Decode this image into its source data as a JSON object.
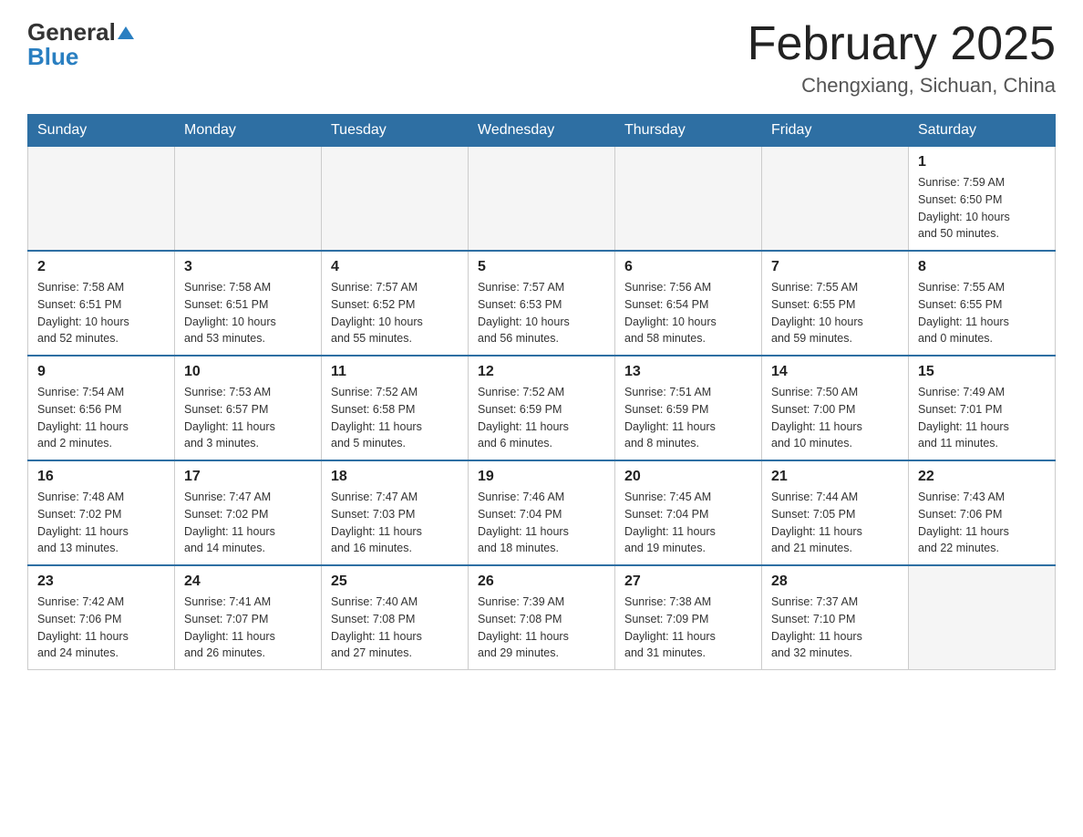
{
  "header": {
    "logo": {
      "general": "General",
      "blue": "Blue"
    },
    "title": "February 2025",
    "location": "Chengxiang, Sichuan, China"
  },
  "days_of_week": [
    "Sunday",
    "Monday",
    "Tuesday",
    "Wednesday",
    "Thursday",
    "Friday",
    "Saturday"
  ],
  "weeks": [
    {
      "days": [
        {
          "number": "",
          "info": ""
        },
        {
          "number": "",
          "info": ""
        },
        {
          "number": "",
          "info": ""
        },
        {
          "number": "",
          "info": ""
        },
        {
          "number": "",
          "info": ""
        },
        {
          "number": "",
          "info": ""
        },
        {
          "number": "1",
          "info": "Sunrise: 7:59 AM\nSunset: 6:50 PM\nDaylight: 10 hours\nand 50 minutes."
        }
      ]
    },
    {
      "days": [
        {
          "number": "2",
          "info": "Sunrise: 7:58 AM\nSunset: 6:51 PM\nDaylight: 10 hours\nand 52 minutes."
        },
        {
          "number": "3",
          "info": "Sunrise: 7:58 AM\nSunset: 6:51 PM\nDaylight: 10 hours\nand 53 minutes."
        },
        {
          "number": "4",
          "info": "Sunrise: 7:57 AM\nSunset: 6:52 PM\nDaylight: 10 hours\nand 55 minutes."
        },
        {
          "number": "5",
          "info": "Sunrise: 7:57 AM\nSunset: 6:53 PM\nDaylight: 10 hours\nand 56 minutes."
        },
        {
          "number": "6",
          "info": "Sunrise: 7:56 AM\nSunset: 6:54 PM\nDaylight: 10 hours\nand 58 minutes."
        },
        {
          "number": "7",
          "info": "Sunrise: 7:55 AM\nSunset: 6:55 PM\nDaylight: 10 hours\nand 59 minutes."
        },
        {
          "number": "8",
          "info": "Sunrise: 7:55 AM\nSunset: 6:55 PM\nDaylight: 11 hours\nand 0 minutes."
        }
      ]
    },
    {
      "days": [
        {
          "number": "9",
          "info": "Sunrise: 7:54 AM\nSunset: 6:56 PM\nDaylight: 11 hours\nand 2 minutes."
        },
        {
          "number": "10",
          "info": "Sunrise: 7:53 AM\nSunset: 6:57 PM\nDaylight: 11 hours\nand 3 minutes."
        },
        {
          "number": "11",
          "info": "Sunrise: 7:52 AM\nSunset: 6:58 PM\nDaylight: 11 hours\nand 5 minutes."
        },
        {
          "number": "12",
          "info": "Sunrise: 7:52 AM\nSunset: 6:59 PM\nDaylight: 11 hours\nand 6 minutes."
        },
        {
          "number": "13",
          "info": "Sunrise: 7:51 AM\nSunset: 6:59 PM\nDaylight: 11 hours\nand 8 minutes."
        },
        {
          "number": "14",
          "info": "Sunrise: 7:50 AM\nSunset: 7:00 PM\nDaylight: 11 hours\nand 10 minutes."
        },
        {
          "number": "15",
          "info": "Sunrise: 7:49 AM\nSunset: 7:01 PM\nDaylight: 11 hours\nand 11 minutes."
        }
      ]
    },
    {
      "days": [
        {
          "number": "16",
          "info": "Sunrise: 7:48 AM\nSunset: 7:02 PM\nDaylight: 11 hours\nand 13 minutes."
        },
        {
          "number": "17",
          "info": "Sunrise: 7:47 AM\nSunset: 7:02 PM\nDaylight: 11 hours\nand 14 minutes."
        },
        {
          "number": "18",
          "info": "Sunrise: 7:47 AM\nSunset: 7:03 PM\nDaylight: 11 hours\nand 16 minutes."
        },
        {
          "number": "19",
          "info": "Sunrise: 7:46 AM\nSunset: 7:04 PM\nDaylight: 11 hours\nand 18 minutes."
        },
        {
          "number": "20",
          "info": "Sunrise: 7:45 AM\nSunset: 7:04 PM\nDaylight: 11 hours\nand 19 minutes."
        },
        {
          "number": "21",
          "info": "Sunrise: 7:44 AM\nSunset: 7:05 PM\nDaylight: 11 hours\nand 21 minutes."
        },
        {
          "number": "22",
          "info": "Sunrise: 7:43 AM\nSunset: 7:06 PM\nDaylight: 11 hours\nand 22 minutes."
        }
      ]
    },
    {
      "days": [
        {
          "number": "23",
          "info": "Sunrise: 7:42 AM\nSunset: 7:06 PM\nDaylight: 11 hours\nand 24 minutes."
        },
        {
          "number": "24",
          "info": "Sunrise: 7:41 AM\nSunset: 7:07 PM\nDaylight: 11 hours\nand 26 minutes."
        },
        {
          "number": "25",
          "info": "Sunrise: 7:40 AM\nSunset: 7:08 PM\nDaylight: 11 hours\nand 27 minutes."
        },
        {
          "number": "26",
          "info": "Sunrise: 7:39 AM\nSunset: 7:08 PM\nDaylight: 11 hours\nand 29 minutes."
        },
        {
          "number": "27",
          "info": "Sunrise: 7:38 AM\nSunset: 7:09 PM\nDaylight: 11 hours\nand 31 minutes."
        },
        {
          "number": "28",
          "info": "Sunrise: 7:37 AM\nSunset: 7:10 PM\nDaylight: 11 hours\nand 32 minutes."
        },
        {
          "number": "",
          "info": ""
        }
      ]
    }
  ]
}
